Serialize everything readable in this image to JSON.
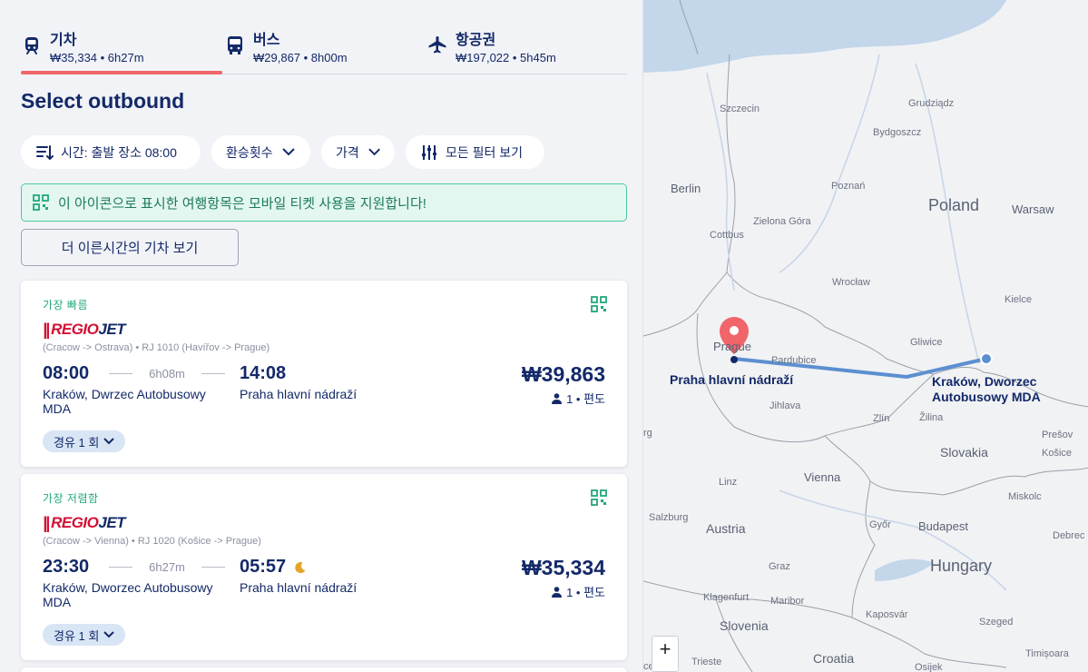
{
  "tabs": [
    {
      "name": "기차",
      "sub": "₩35,334 • 6h27m",
      "icon": "train-icon",
      "active": true
    },
    {
      "name": "버스",
      "sub": "₩29,867 • 8h00m",
      "icon": "bus-icon",
      "active": false
    },
    {
      "name": "항공권",
      "sub": "₩197,022 • 5h45m",
      "icon": "plane-icon",
      "active": false
    }
  ],
  "page_title": "Select outbound",
  "filters": {
    "time": "시간: 출발 장소 08:00",
    "transfers": "환승횟수",
    "price": "가격",
    "all_filters": "모든 필터 보기"
  },
  "notice": "이 아이콘으로 표시한 여행항목은 모바일 티켓 사용을 지원합니다!",
  "earlier_button": "더 이른시간의 기차 보기",
  "results": [
    {
      "badge": "가장 빠름",
      "operator_bars": "||",
      "operator_a": "REGIO",
      "operator_b": "JET",
      "route": "(Cracow -> Ostrava) • RJ 1010 (Havířov -> Prague)",
      "dep_time": "08:00",
      "duration": "6h08m",
      "arr_time": "14:08",
      "dep_station": "Kraków, Dwrzec Autobusowy MDA",
      "arr_station": "Praha hlavní nádraží",
      "price": "₩39,863",
      "pax": "1 • 편도",
      "stops": "경유 1 회",
      "overnight": false
    },
    {
      "badge": "가장 저렴함",
      "operator_bars": "||",
      "operator_a": "REGIO",
      "operator_b": "JET",
      "route": "(Cracow -> Vienna) • RJ 1020 (Košice -> Prague)",
      "dep_time": "23:30",
      "duration": "6h27m",
      "arr_time": "05:57",
      "dep_station": "Kraków, Dworzec Autobusowy MDA",
      "arr_station": "Praha hlavní nádraží",
      "price": "₩35,334",
      "pax": "1 • 편도",
      "stops": "경유 1 회",
      "overnight": true
    }
  ],
  "map": {
    "countries": {
      "poland": "Poland",
      "slovakia": "Slovakia",
      "austria": "Austria",
      "hungary": "Hungary",
      "slovenia": "Slovenia",
      "croatia": "Croatia"
    },
    "capitals": {
      "berlin": "Berlin",
      "warsaw": "Warsaw",
      "prague": "Prague",
      "vienna": "Vienna",
      "budapest": "Budapest"
    },
    "cities": {
      "szczecin": "Szczecin",
      "grudziadz": "Grudziądz",
      "bydgoszcz": "Bydgoszcz",
      "poznan": "Poznań",
      "zielona": "Zielona Góra",
      "cottbus": "Cottbus",
      "wroclaw": "Wrocław",
      "kielce": "Kielce",
      "pardubice": "Pardubice",
      "gliwice": "Gliwice",
      "jihlava": "Jihlava",
      "zlin": "Zlín",
      "zilina": "Žilina",
      "presov": "Prešov",
      "kosice": "Košice",
      "linz": "Linz",
      "salzburg": "Salzburg",
      "miskolc": "Miskolc",
      "gyor": "Győr",
      "debrecen": "Debrec",
      "graz": "Graz",
      "klagenfurt": "Klagenfurt",
      "maribor": "Maribor",
      "kaposvar": "Kaposvár",
      "szeged": "Szeged",
      "trieste": "Trieste",
      "osijek": "Osijek",
      "timisoara": "Timișoara",
      "rg": "rg",
      "ce": "ce"
    },
    "origin_label": "Kraków, Dworzec Autobusowy MDA",
    "dest_label": "Praha hlavní nádraží",
    "zoom_in": "+"
  },
  "colors": {
    "accent": "#f0656a",
    "navy": "#132968",
    "green": "#23a87c",
    "route": "#5b8fd0"
  }
}
